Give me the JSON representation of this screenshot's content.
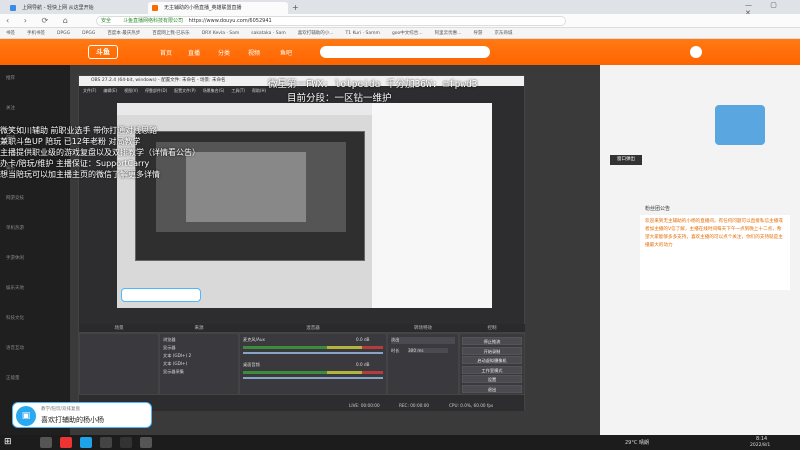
{
  "browser": {
    "tabs": [
      {
        "label": "上网导航 - 轻快上网 从这里开始",
        "active": false
      },
      {
        "label": "无主辅助的小杨直播_英雄联盟直播",
        "active": true
      }
    ],
    "url_prefix": "安全",
    "url_site": "斗鱼直播网络科技有限公司",
    "url": "https://www.douyu.com/6052941",
    "bookmarks": [
      "书签",
      "手机书签",
      "DPGG",
      "DPGG",
      "百度本·最庆热步",
      "百度网上我·已乐乐",
      "DRX Kevla · Sam",
      "sakataka · Sam",
      "喜欢打辅助的小...",
      "T1 Kuri · Samm",
      "goo中文综合...",
      "阿里云优惠...",
      "导游",
      "京东商城"
    ]
  },
  "header": {
    "nav": [
      "首页",
      "直播",
      "分类",
      "视频",
      "鱼吧"
    ],
    "logo": "斗鱼"
  },
  "sidebar": {
    "items": [
      "推荐",
      "关注",
      "游戏",
      "娱乐",
      "网游竞技",
      "单机热游",
      "手游休闲",
      "娱乐天地",
      "科技文化",
      "语音互动",
      "正能量"
    ]
  },
  "overlay": {
    "line1": "微星第一FWX: lolpeida 千分加36W: mfpwd3",
    "line2": "目前分段：一区钻一维护"
  },
  "obs": {
    "title": "OBS 27.2.4 (64-bit, windows) - 配置文件: 未命名 - 场景: 未命名",
    "menu": [
      "文件(F)",
      "编辑(E)",
      "视图(V)",
      "停靠部件(D)",
      "配置文件(P)",
      "场景集合(S)",
      "工具(T)",
      "帮助(H)"
    ],
    "left_info": [
      "微笑如川辅助 前职业选手 带你打通对线思路",
      "兼职斗鱼UP 陪玩 已12年老粉 对局教学",
      "主播提供职业级的游戏复盘以及双排教学（详情看公告）",
      "办卡/陪玩/维护 主播保证：SupportCarry",
      "想当陪玩可以加主播主页的微信了解更多详情"
    ],
    "docks": {
      "scenes": "场景",
      "sources": "来源",
      "mixer": "混音器",
      "transitions": "转场特效",
      "controls": "控制"
    },
    "sources": [
      "浏览器",
      "显示器",
      "文本 (GDI+) 2",
      "文本 (GDI+)",
      "显示器采集"
    ],
    "mixer_tracks": [
      {
        "name": "麦克风/Aux",
        "db": "0.0 dB"
      },
      {
        "name": "桌面音频",
        "db": "0.0 dB"
      }
    ],
    "transition": {
      "type": "淡出",
      "duration_label": "时长",
      "duration": "300 ms"
    },
    "controls": [
      "停止推流",
      "开始录制",
      "启动虚拟摄像机",
      "工作室模式",
      "设置",
      "退出"
    ],
    "status": {
      "drops": "丢帧 0 (0.0%)",
      "live": "LIVE: 00:00:00",
      "rec": "REC: 00:00:00",
      "cpu": "CPU: 0.0%, 60.00 fps"
    }
  },
  "right_panel": {
    "popup_btn": "窗口弹出",
    "notice_title": "粉丝团公告",
    "notice": "欢迎来到无主辅助的小杨的直播间，有任何问题可以直接私信主播或者加主播的V信了解，主播在线时间每天下午一点到晚上十二点，希望大家能够多多支持，喜欢主播的可以点个关注，你们的支持就是主播最大的动力"
  },
  "badge": {
    "top": "教学/陪玩/双排复盘",
    "name": "喜欢打辅助的杨小杨"
  },
  "taskbar": {
    "weather": "29°C 晴朗",
    "time": "8:14",
    "date": "2022/8/1"
  }
}
